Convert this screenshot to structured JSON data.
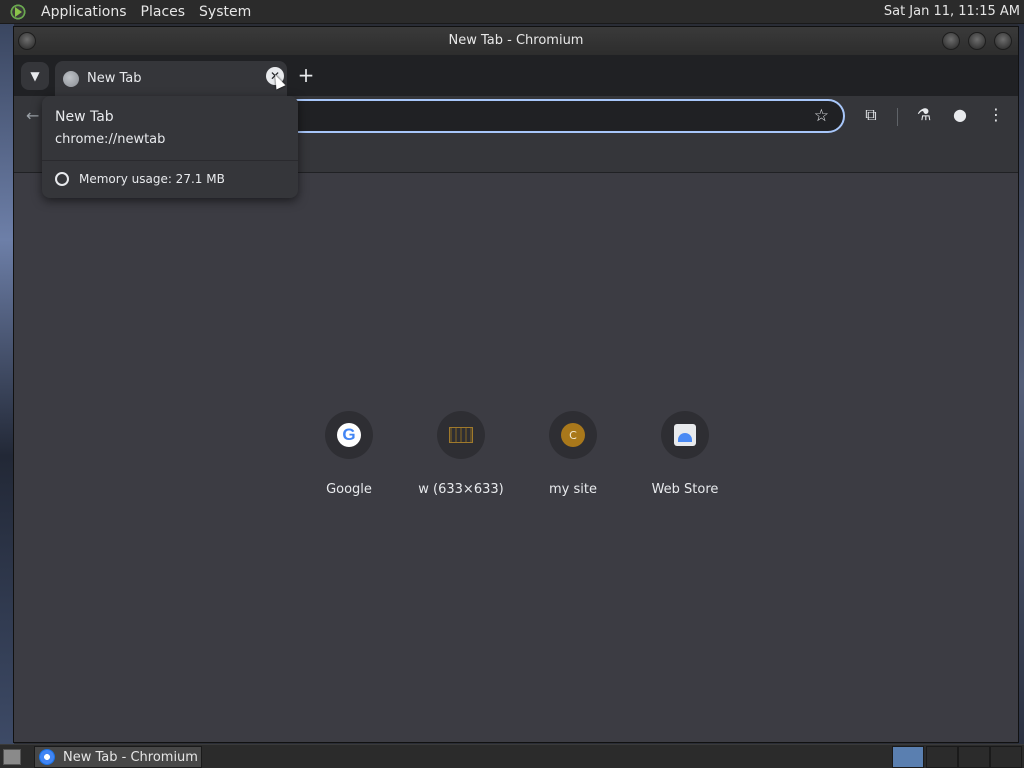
{
  "top_panel": {
    "menus": [
      "Applications",
      "Places",
      "System"
    ],
    "clock": "Sat Jan 11, 11:15 AM"
  },
  "window": {
    "title": "New Tab - Chromium"
  },
  "tab": {
    "title": "New Tab",
    "close_glyph": "✕"
  },
  "toolbar": {
    "back_glyph": "←",
    "star_glyph": "☆",
    "new_tab_glyph": "+"
  },
  "hovercard": {
    "title": "New Tab",
    "url": "chrome://newtab",
    "memory": "Memory usage: 27.1 MB"
  },
  "shortcuts": [
    {
      "label": "Google",
      "icon": "google-icon"
    },
    {
      "label": "w (633×633)",
      "icon": "image-thumbnail-icon"
    },
    {
      "label": "my site",
      "icon": "letter-c-icon",
      "letter": "C"
    },
    {
      "label": "Web Store",
      "icon": "web-store-icon"
    }
  ],
  "taskbar": {
    "task_label": "New Tab - Chromium"
  },
  "colors": {
    "page_bg": "#3c3c43",
    "toolbar_bg": "#35363a",
    "tabstrip_bg": "#202124",
    "omnibox_border": "#a8c7fa"
  }
}
